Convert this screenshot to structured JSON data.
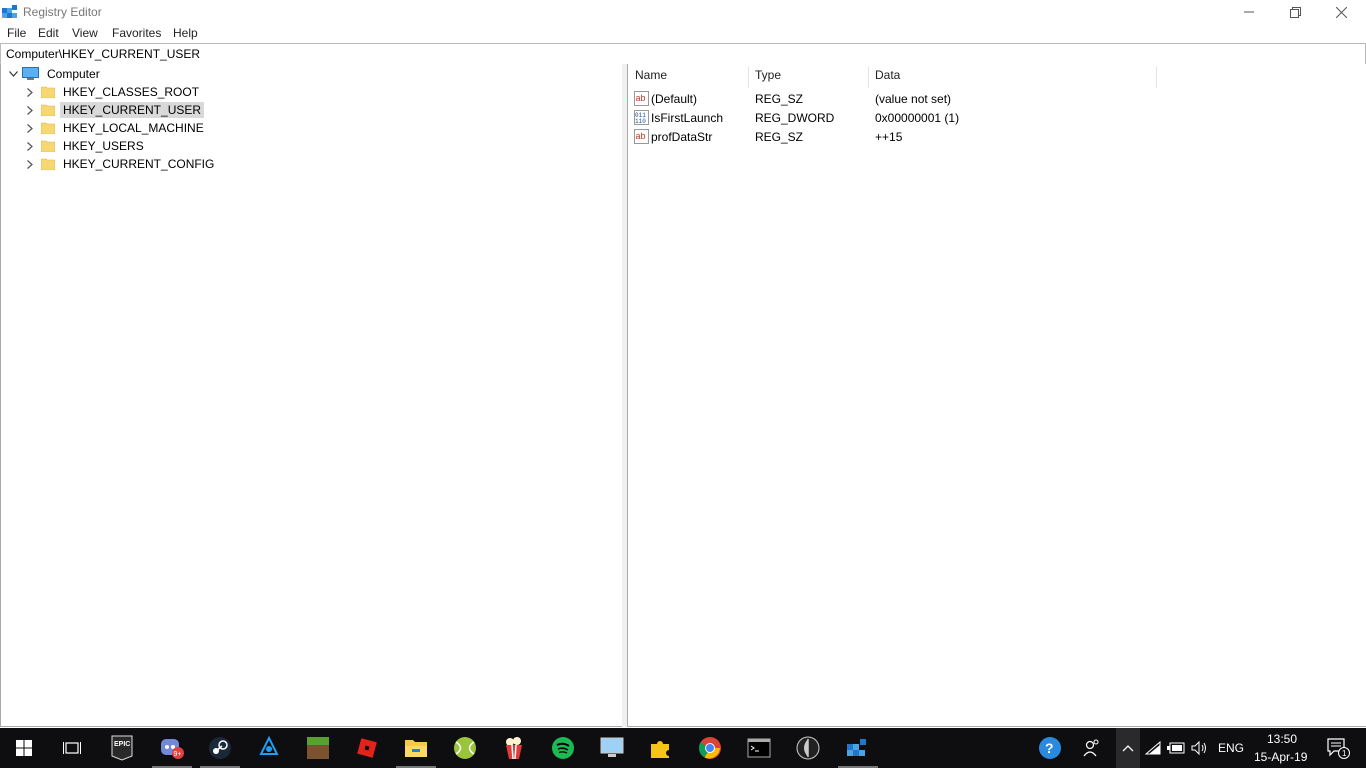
{
  "window": {
    "title": "Registry Editor"
  },
  "menu": [
    "File",
    "Edit",
    "View",
    "Favorites",
    "Help"
  ],
  "address": "Computer\\HKEY_CURRENT_USER",
  "tree": {
    "root": "Computer",
    "keys": [
      {
        "label": "HKEY_CLASSES_ROOT",
        "selected": false
      },
      {
        "label": "HKEY_CURRENT_USER",
        "selected": true
      },
      {
        "label": "HKEY_LOCAL_MACHINE",
        "selected": false
      },
      {
        "label": "HKEY_USERS",
        "selected": false
      },
      {
        "label": "HKEY_CURRENT_CONFIG",
        "selected": false
      }
    ]
  },
  "columns": {
    "name": "Name",
    "type": "Type",
    "data": "Data"
  },
  "values": [
    {
      "name": "(Default)",
      "type": "REG_SZ",
      "data": "(value not set)",
      "icon": "string-value-icon"
    },
    {
      "name": "IsFirstLaunch",
      "type": "REG_DWORD",
      "data": "0x00000001 (1)",
      "icon": "binary-value-icon"
    },
    {
      "name": "profDataStr",
      "type": "REG_SZ",
      "data": "++15",
      "icon": "string-value-icon"
    }
  ],
  "taskbar": {
    "apps": [
      {
        "name": "epic-games-icon",
        "running": false
      },
      {
        "name": "discord-icon",
        "running": true,
        "badge": "9+"
      },
      {
        "name": "steam-icon",
        "running": true
      },
      {
        "name": "battlenet-icon",
        "running": false
      },
      {
        "name": "minecraft-icon",
        "running": false
      },
      {
        "name": "roblox-icon",
        "running": false
      },
      {
        "name": "file-explorer-icon",
        "running": true
      },
      {
        "name": "tennis-ball-icon",
        "running": false
      },
      {
        "name": "popcorn-icon",
        "running": false
      },
      {
        "name": "spotify-icon",
        "running": false
      },
      {
        "name": "remote-desktop-icon",
        "running": false
      },
      {
        "name": "puzzle-icon",
        "running": false
      },
      {
        "name": "chrome-icon",
        "running": false
      },
      {
        "name": "cmd-icon",
        "running": false
      },
      {
        "name": "unity-icon",
        "running": false
      },
      {
        "name": "registry-editor-icon",
        "running": true
      }
    ],
    "tray": {
      "language": "ENG",
      "time": "13:50",
      "date": "15-Apr-19",
      "notifications": "1"
    }
  }
}
